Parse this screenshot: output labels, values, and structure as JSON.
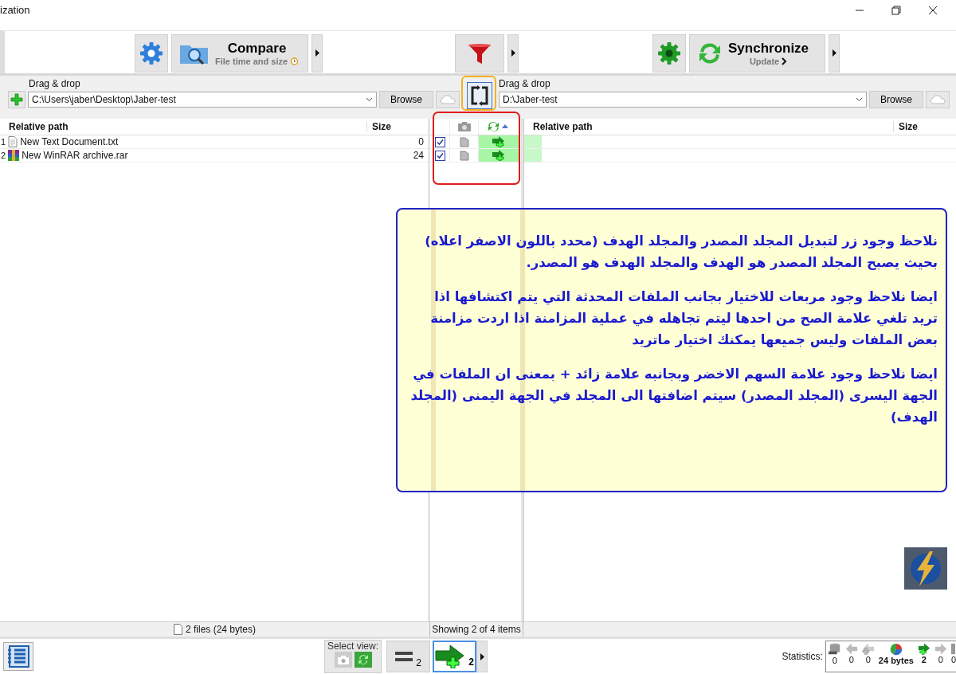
{
  "window": {
    "title": "ization"
  },
  "toolbar": {
    "compare": {
      "label": "Compare",
      "variant": "File time and size"
    },
    "synchronize": {
      "label": "Synchronize",
      "variant": "Update"
    }
  },
  "left_folder": {
    "hint": "Drag & drop",
    "path": "C:\\Users\\jaber\\Desktop\\Jaber-test",
    "browse": "Browse"
  },
  "right_folder": {
    "hint": "Drag & drop",
    "path": "D:\\Jaber-test",
    "browse": "Browse"
  },
  "left_table": {
    "columns": [
      "Relative path",
      "Size"
    ],
    "rows": [
      {
        "number": "1",
        "name": "New Text Document.txt",
        "size": "0",
        "kind": "text"
      },
      {
        "number": "2",
        "name": "New WinRAR archive.rar",
        "size": "24",
        "kind": "archive"
      }
    ]
  },
  "middle_rows": [
    {
      "checked": true,
      "kind": "create_right"
    },
    {
      "checked": true,
      "kind": "create_right"
    }
  ],
  "right_table": {
    "columns": [
      "Relative path",
      "Size"
    ]
  },
  "note": {
    "paragraphs": [
      "نلاحظ وجود زر لتبديل المجلد المصدر والمجلد الهدف (محدد باللون الاصفر اعلاه) بحيث يصبح المجلد المصدر هو الهدف والمجلد الهدف هو المصدر.",
      "ايضا نلاحظ وجود مربعات للاختيار بجانب الملفات المحدثة التي يتم اكتشافها اذا تريد تلغي علامة الصح من احدها ليتم تجاهله في عملية المزامنة اذا اردت مزامنة بعض الملفات وليس جميعها يمكنك اختيار ماتريد",
      "ايضا نلاحظ وجود علامة السهم الاخضر وبجانبه علامة زائد + بمعنى ان الملفات في الجهة اليسرى (المجلد المصدر) سيتم اضافتها الى المجلد في الجهة اليمنى (المجلد الهدف)"
    ]
  },
  "status_bar": {
    "left": "2 files (24 bytes)",
    "middle": "Showing 2 of 4 items"
  },
  "bottom_bar": {
    "select_view_label": "Select view:",
    "select_view": [
      {
        "kind": "camera",
        "on": false
      },
      {
        "kind": "sync",
        "on": true
      }
    ],
    "view_buttons": [
      {
        "kind": "equal",
        "count": "2",
        "selected": false
      },
      {
        "kind": "create_right",
        "count": "2",
        "selected": true
      }
    ],
    "statistics_label": "Statistics:",
    "statistics": [
      "0",
      "0",
      "0",
      "24 bytes",
      "2",
      "0",
      "0"
    ]
  }
}
